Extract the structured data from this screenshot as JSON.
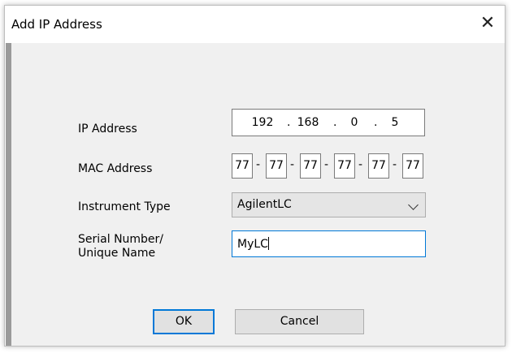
{
  "dialog": {
    "title": "Add IP Address",
    "close_glyph": "✕"
  },
  "fields": {
    "ip_label": "IP Address",
    "ip_octets": [
      "192",
      "168",
      "0",
      "5"
    ],
    "mac_label": "MAC Address",
    "mac_octets": [
      "77",
      "77",
      "77",
      "77",
      "77",
      "77"
    ],
    "mac_separator": "-",
    "ip_separator": ".",
    "instrument_label": "Instrument Type",
    "instrument_value": "AgilentLC",
    "serial_label_line1": "Serial Number/",
    "serial_label_line2": "Unique Name",
    "serial_value": "MyLC"
  },
  "buttons": {
    "ok": "OK",
    "cancel": "Cancel"
  },
  "colors": {
    "focus_accent": "#0078d7",
    "dialog_background": "#f0f0f0"
  },
  "icons": [
    "close-icon",
    "chevron-down-icon"
  ]
}
